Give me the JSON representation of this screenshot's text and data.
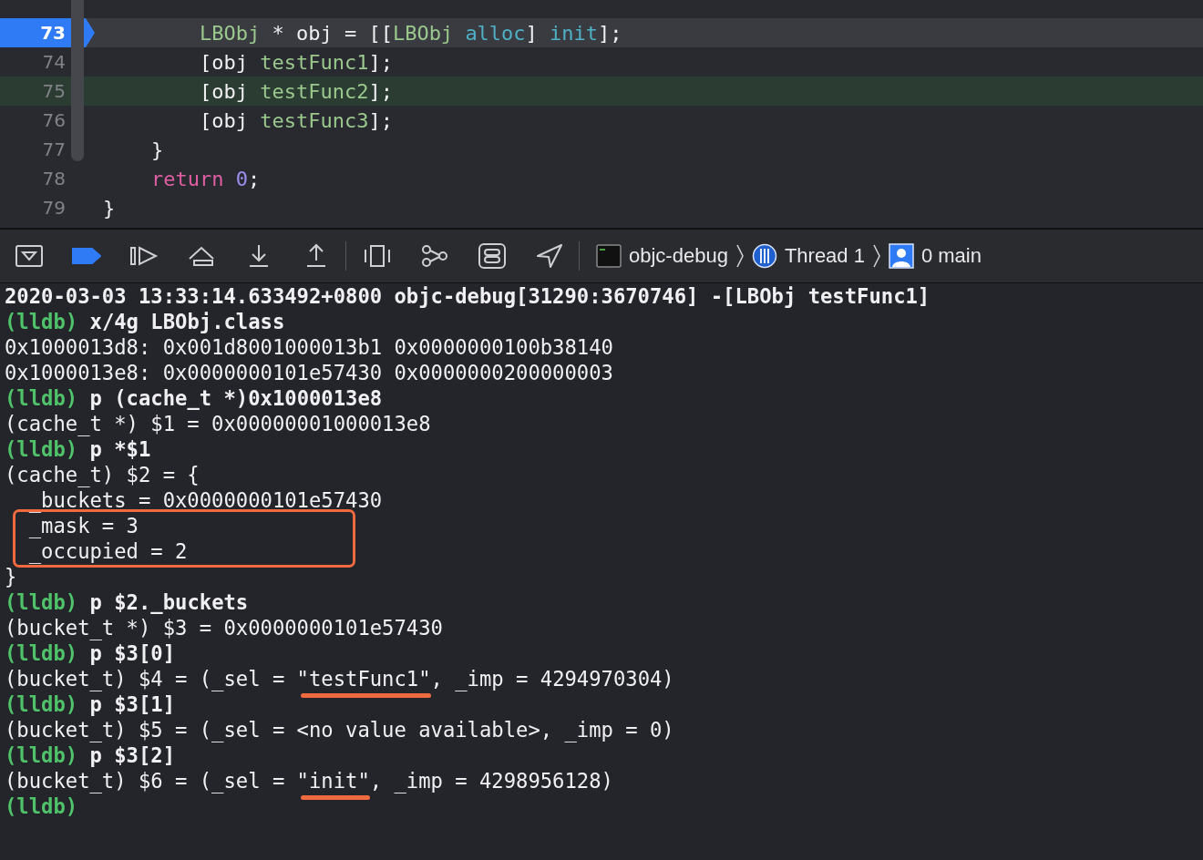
{
  "code_editor": {
    "lines": [
      {
        "number": "73",
        "current": true,
        "highlighted": false,
        "tokens": [
          {
            "text": "        LBObj",
            "kind": "class"
          },
          {
            "text": " * obj = [[",
            "kind": "plain"
          },
          {
            "text": "LBObj ",
            "kind": "class"
          },
          {
            "text": "alloc",
            "kind": "method"
          },
          {
            "text": "] ",
            "kind": "plain"
          },
          {
            "text": "init",
            "kind": "method"
          },
          {
            "text": "];",
            "kind": "plain"
          }
        ]
      },
      {
        "number": "74",
        "current": false,
        "highlighted": false,
        "tokens": [
          {
            "text": "        [obj ",
            "kind": "plain"
          },
          {
            "text": "testFunc1",
            "kind": "project_method"
          },
          {
            "text": "];",
            "kind": "plain"
          }
        ]
      },
      {
        "number": "75",
        "current": false,
        "highlighted": true,
        "tokens": [
          {
            "text": "        [obj ",
            "kind": "plain"
          },
          {
            "text": "testFunc2",
            "kind": "project_method"
          },
          {
            "text": "];",
            "kind": "plain"
          }
        ]
      },
      {
        "number": "76",
        "current": false,
        "highlighted": false,
        "tokens": [
          {
            "text": "        [obj ",
            "kind": "plain"
          },
          {
            "text": "testFunc3",
            "kind": "project_method"
          },
          {
            "text": "];",
            "kind": "plain"
          }
        ]
      },
      {
        "number": "77",
        "current": false,
        "highlighted": false,
        "tokens": [
          {
            "text": "    }",
            "kind": "plain"
          }
        ]
      },
      {
        "number": "78",
        "current": false,
        "highlighted": false,
        "tokens": [
          {
            "text": "    return",
            "kind": "keyword"
          },
          {
            "text": " 0",
            "kind": "number"
          },
          {
            "text": ";",
            "kind": "plain"
          }
        ]
      },
      {
        "number": "79",
        "current": false,
        "highlighted": false,
        "tokens": [
          {
            "text": "}",
            "kind": "plain"
          }
        ]
      }
    ]
  },
  "debug_bar": {
    "breakpoints_active": true,
    "breadcrumbs": [
      {
        "kind": "app",
        "label": "objc-debug"
      },
      {
        "kind": "thread",
        "label": "Thread 1"
      },
      {
        "kind": "frame",
        "label": "0 main"
      }
    ]
  },
  "console": {
    "lines": [
      {
        "kind": "log",
        "boxed": false,
        "parts": [
          {
            "text": "2020-03-03 13:33:14.633492+0800 objc-debug[31290:3670746] -[LBObj testFunc1]",
            "underlined": false
          }
        ]
      },
      {
        "kind": "input",
        "boxed": false,
        "prompt": "(lldb)",
        "parts": [
          {
            "text": "x/4g LBObj.class",
            "underlined": false
          }
        ]
      },
      {
        "kind": "output",
        "boxed": false,
        "parts": [
          {
            "text": "0x1000013d8: 0x001d8001000013b1 0x0000000100b38140",
            "underlined": false
          }
        ]
      },
      {
        "kind": "output",
        "boxed": false,
        "parts": [
          {
            "text": "0x1000013e8: 0x0000000101e57430 0x0000000200000003",
            "underlined": false
          }
        ]
      },
      {
        "kind": "input",
        "boxed": false,
        "prompt": "(lldb)",
        "parts": [
          {
            "text": "p (cache_t *)0x1000013e8",
            "underlined": false
          }
        ]
      },
      {
        "kind": "output",
        "boxed": false,
        "parts": [
          {
            "text": "(cache_t *) $1 = 0x00000001000013e8",
            "underlined": false
          }
        ]
      },
      {
        "kind": "input",
        "boxed": false,
        "prompt": "(lldb)",
        "parts": [
          {
            "text": "p *$1",
            "underlined": false
          }
        ]
      },
      {
        "kind": "output",
        "boxed": false,
        "parts": [
          {
            "text": "(cache_t) $2 = {",
            "underlined": false
          }
        ]
      },
      {
        "kind": "output",
        "boxed": false,
        "parts": [
          {
            "text": "  _buckets = 0x0000000101e57430",
            "underlined": false
          }
        ]
      },
      {
        "kind": "output",
        "boxed": true,
        "parts": [
          {
            "text": "  _mask = 3",
            "underlined": false
          }
        ]
      },
      {
        "kind": "output",
        "boxed": true,
        "parts": [
          {
            "text": "  _occupied = 2",
            "underlined": false
          }
        ]
      },
      {
        "kind": "output",
        "boxed": false,
        "parts": [
          {
            "text": "}",
            "underlined": false
          }
        ]
      },
      {
        "kind": "input",
        "boxed": false,
        "prompt": "(lldb)",
        "parts": [
          {
            "text": "p $2._buckets",
            "underlined": false
          }
        ]
      },
      {
        "kind": "output",
        "boxed": false,
        "parts": [
          {
            "text": "(bucket_t *) $3 = 0x0000000101e57430",
            "underlined": false
          }
        ]
      },
      {
        "kind": "input",
        "boxed": false,
        "prompt": "(lldb)",
        "parts": [
          {
            "text": "p $3[0]",
            "underlined": false
          }
        ]
      },
      {
        "kind": "output",
        "boxed": false,
        "parts": [
          {
            "text": "(bucket_t) $4 = (_sel = ",
            "underlined": false
          },
          {
            "text": "\"testFunc1\"",
            "underlined": true
          },
          {
            "text": ", _imp = 4294970304)",
            "underlined": false
          }
        ]
      },
      {
        "kind": "input",
        "boxed": false,
        "prompt": "(lldb)",
        "parts": [
          {
            "text": "p $3[1]",
            "underlined": false
          }
        ]
      },
      {
        "kind": "output",
        "boxed": false,
        "parts": [
          {
            "text": "(bucket_t) $5 = (_sel = <no value available>, _imp = 0)",
            "underlined": false
          }
        ]
      },
      {
        "kind": "input",
        "boxed": false,
        "prompt": "(lldb)",
        "parts": [
          {
            "text": "p $3[2]",
            "underlined": false
          }
        ]
      },
      {
        "kind": "output",
        "boxed": false,
        "parts": [
          {
            "text": "(bucket_t) $6 = (_sel = ",
            "underlined": false
          },
          {
            "text": "\"init\"",
            "underlined": true
          },
          {
            "text": ", _imp = 4298956128)",
            "underlined": false
          }
        ]
      },
      {
        "kind": "input",
        "boxed": false,
        "prompt": "(lldb)"
      }
    ]
  }
}
